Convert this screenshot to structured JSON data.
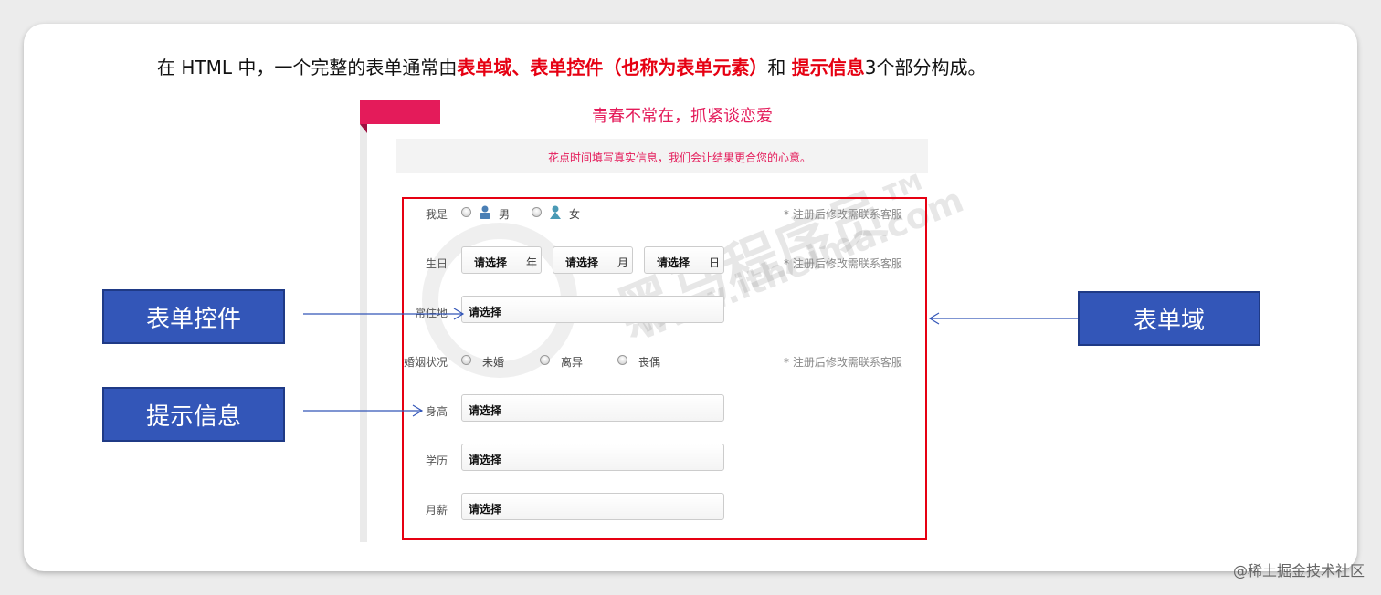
{
  "heading": {
    "part1": "在 HTML 中，一个完整的表单通常由",
    "red1": "表单域、表单控件（也称为表单元素）",
    "part2": "和 ",
    "red2": "提示信息",
    "part3": "3个部分构成。"
  },
  "form": {
    "title": "青春不常在，抓紧谈恋爱",
    "banner": "花点时间填写真实信息，我们会让结果更合您的心意。",
    "rows": {
      "gender": {
        "label": "我是",
        "male": "男",
        "female": "女",
        "note": "* 注册后修改需联系客服"
      },
      "birthday": {
        "label": "生日",
        "year_value": "请选择",
        "year_unit": "年",
        "month_value": "请选择",
        "month_unit": "月",
        "day_value": "请选择",
        "day_unit": "日",
        "note": "* 注册后修改需联系客服"
      },
      "residence": {
        "label": "常住地",
        "value": "请选择"
      },
      "marital": {
        "label": "婚姻状况",
        "opt1": "未婚",
        "opt2": "离异",
        "opt3": "丧偶",
        "note": "* 注册后修改需联系客服"
      },
      "height": {
        "label": "身高",
        "value": "请选择"
      },
      "education": {
        "label": "学历",
        "value": "请选择"
      },
      "salary": {
        "label": "月薪",
        "value": "请选择"
      }
    }
  },
  "watermark": {
    "line1": "黑马程序员™",
    "line2": "www.itheima.com"
  },
  "callouts": {
    "controls": "表单控件",
    "hint": "提示信息",
    "domain": "表单域"
  },
  "footer": "@稀土掘金技术社区",
  "colors": {
    "accent_red": "#e60012",
    "pink": "#e41b5a",
    "callout_blue": "#3356b8"
  }
}
